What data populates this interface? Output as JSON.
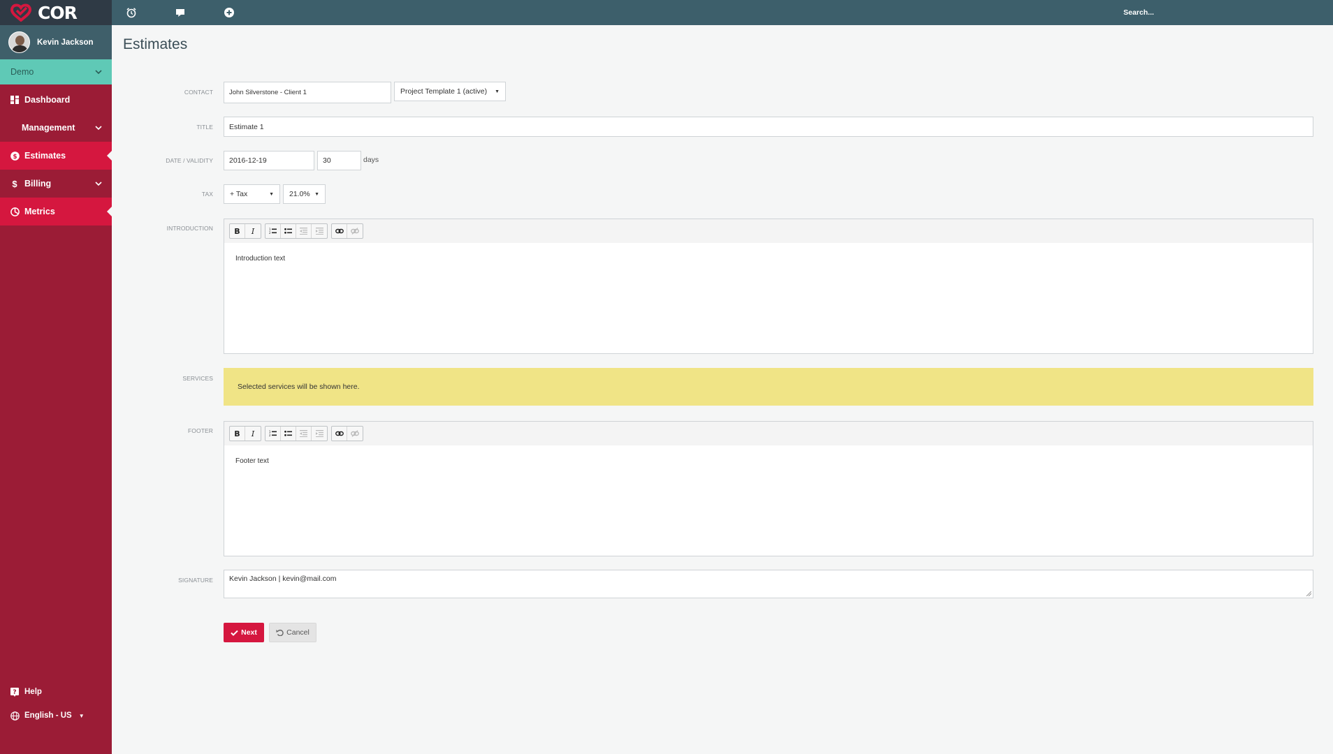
{
  "app": {
    "logo_text": "COR",
    "brand_color": "#d5173f"
  },
  "user": {
    "name": "Kevin Jackson"
  },
  "org": {
    "selected": "Demo"
  },
  "sidebar": {
    "items": [
      {
        "label": "Dashboard",
        "icon": "dashboard-icon"
      },
      {
        "label": "Management",
        "icon": "none",
        "expandable": true
      },
      {
        "label": "Estimates",
        "icon": "dollar-circle-icon",
        "active": true
      },
      {
        "label": "Billing",
        "icon": "dollar-icon",
        "expandable": true
      },
      {
        "label": "Metrics",
        "icon": "pie-chart-icon",
        "active": true
      }
    ],
    "help_label": "Help",
    "language_label": "English - US"
  },
  "topbar": {
    "icons": [
      "alarm-clock-icon",
      "message-icon",
      "add-circle-icon"
    ],
    "search_label": "Search..."
  },
  "page": {
    "title": "Estimates"
  },
  "form": {
    "contact": {
      "label": "CONTACT",
      "value": "John Silverstone - Client 1",
      "template": "Project Template 1 (active)"
    },
    "title": {
      "label": "TITLE",
      "value": "Estimate 1"
    },
    "date": {
      "label": "DATE / VALIDITY",
      "value": "2016-12-19",
      "validity": "30",
      "unit": "days"
    },
    "tax": {
      "label": "TAX",
      "type": "+ Tax",
      "rate": "21.0%"
    },
    "introduction": {
      "label": "INTRODUCTION",
      "text": "Introduction text"
    },
    "services": {
      "label": "SERVICES",
      "text": "Selected services will be shown here."
    },
    "footer": {
      "label": "FOOTER",
      "text": "Footer text"
    },
    "signature": {
      "label": "SIGNATURE",
      "value": "Kevin Jackson | kevin@mail.com"
    }
  },
  "buttons": {
    "next": "Next",
    "cancel": "Cancel"
  }
}
